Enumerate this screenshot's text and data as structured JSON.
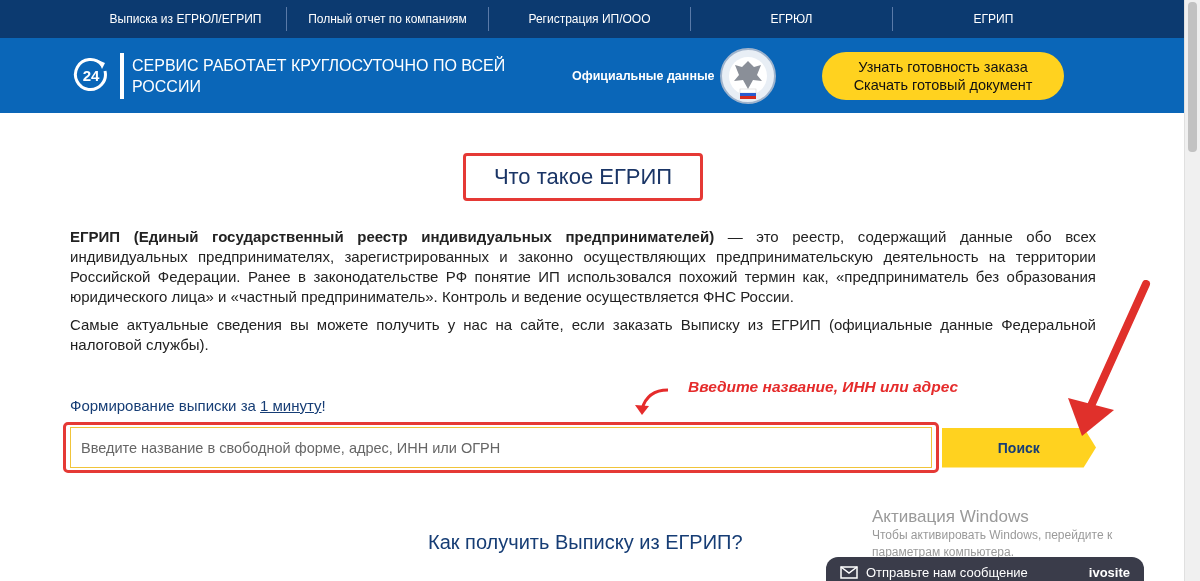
{
  "nav": {
    "items": [
      "Выписка из ЕГРЮЛ/ЕГРИП",
      "Полный отчет по компаниям",
      "Регистрация ИП/ООО",
      "ЕГРЮЛ",
      "ЕГРИП"
    ]
  },
  "header": {
    "slogan": "СЕРВИС РАБОТАЕТ КРУГЛОСУТОЧНО ПО ВСЕЙ РОССИИ",
    "logo": "24",
    "official": "Официальные данные",
    "order_button": [
      "Узнать готовность заказа",
      "Скачать готовый документ"
    ]
  },
  "title": "Что такое ЕГРИП",
  "paragraphs": [
    "**ЕГРИП (Единый государственный реестр индивидуальных предпринимателей)** — это реестр, содержащий данные обо всех индивидуальных предпринимателях, зарегистрированных и законно осуществляющих предпринимательскую деятельность на территории Российской Федерации. Ранее в законодательстве РФ понятие ИП использовался похожий термин как, «предприниматель без образования юридического лица» и «частный предприниматель». Контроль и ведение осуществляется ФНС России.",
    "Самые актуальные сведения вы можете получить у нас на сайте, если заказать Выписку из ЕГРИП (официальные данные Федеральной налоговой службы)."
  ],
  "form": {
    "label": "Формирование выписки за ",
    "link": "1 минуту",
    "label_end": "!",
    "placeholder": "Введите название в свободной форме, адрес, ИНН или ОГРН",
    "button": "Поиск"
  },
  "annotation": "Введите название, ИНН или адрес",
  "subheading": "Как получить Выписку из ЕГРИП?",
  "windows_notice": {
    "title": "Активация Windows",
    "lines": [
      "Чтобы активировать Windows, перейдите к",
      "параметрам компьютера."
    ]
  },
  "chat": {
    "label": "Отправьте нам сообщение",
    "brand": "ivosite"
  }
}
